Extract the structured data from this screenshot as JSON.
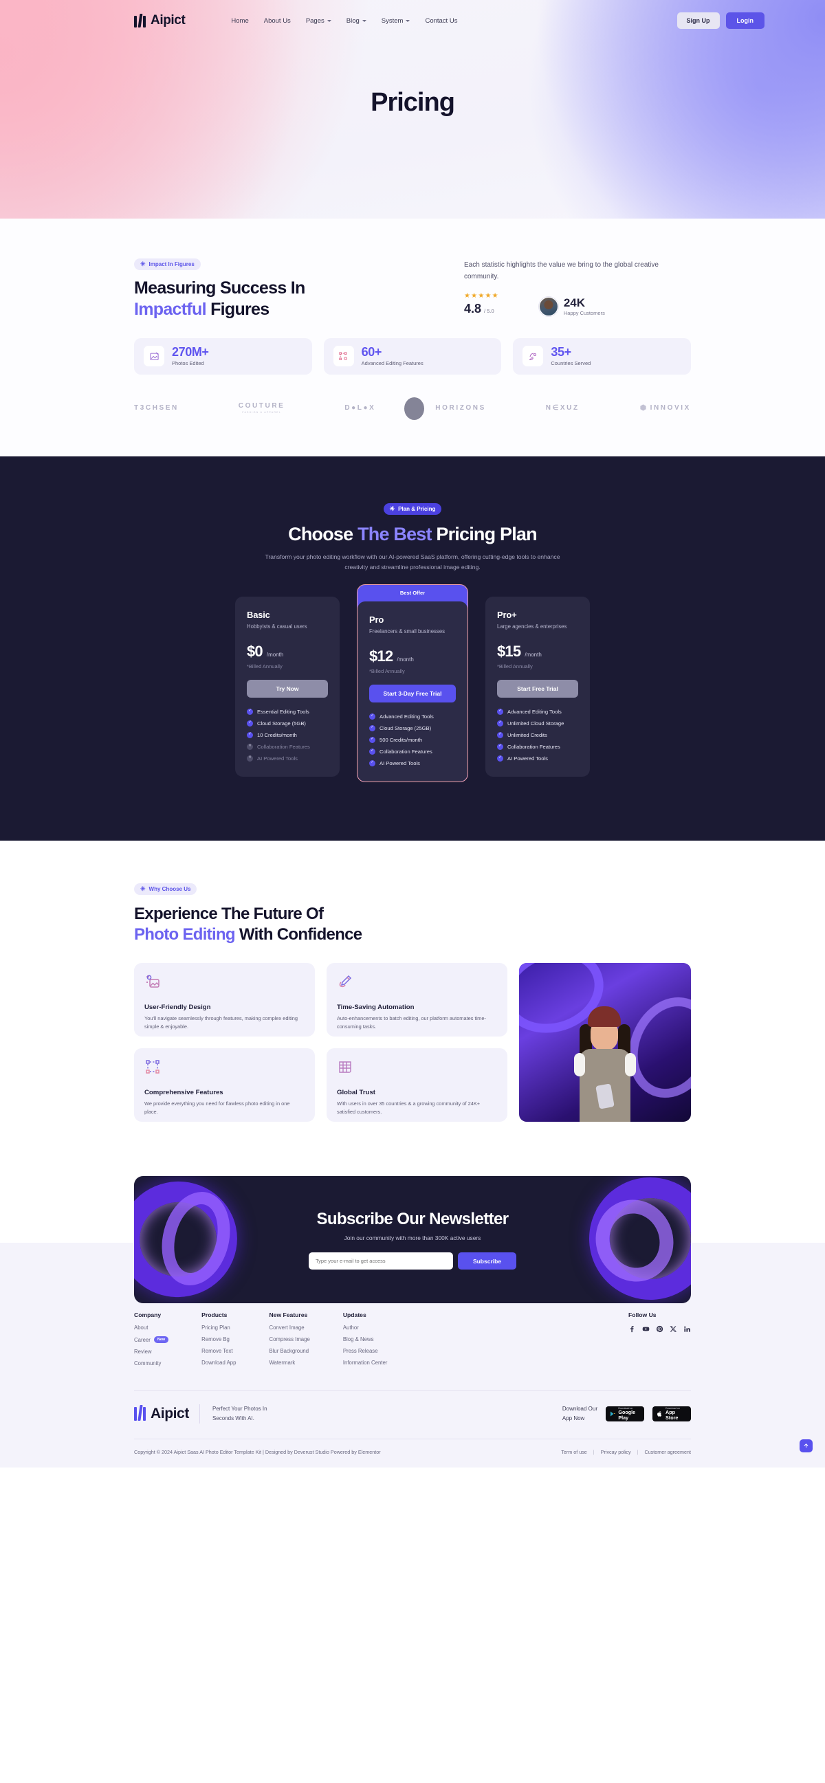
{
  "nav": {
    "brand": "Aipict",
    "links": [
      {
        "label": "Home",
        "caret": false
      },
      {
        "label": "About Us",
        "caret": false
      },
      {
        "label": "Pages",
        "caret": true
      },
      {
        "label": "Blog",
        "caret": true
      },
      {
        "label": "System",
        "caret": true
      },
      {
        "label": "Contact Us",
        "caret": false
      }
    ],
    "signup": "Sign Up",
    "login": "Login"
  },
  "hero": {
    "title": "Pricing"
  },
  "stats": {
    "pill": "Impact In Figures",
    "heading_line1": "Measuring Success In",
    "heading_accent": "Impactful",
    "heading_rest": " Figures",
    "intro": "Each statistic highlights the value we bring to the global creative community.",
    "stars": "★★★★★",
    "rating": "4.8",
    "rating_out_of": "/ 5.0",
    "customers_count": "24K",
    "customers_label": "Happy Customers",
    "cards": [
      {
        "value": "270M+",
        "label": "Photos Edited",
        "icon": "image-edit-icon"
      },
      {
        "value": "60+",
        "label": "Advanced Editing Features",
        "icon": "nodes-settings-icon"
      },
      {
        "value": "35+",
        "label": "Countries Served",
        "icon": "satellite-dish-icon"
      }
    ],
    "logos": [
      {
        "name": "T3CHSEN",
        "sub": ""
      },
      {
        "name": "COUTURE",
        "sub": "FASHION & APPAREL"
      },
      {
        "name": "D●L●X",
        "sub": ""
      },
      {
        "name": "HORIZONS",
        "sub": ""
      },
      {
        "name": "N∈XUZ",
        "sub": ""
      },
      {
        "name": "INNOVIX",
        "sub": ""
      }
    ]
  },
  "pricing": {
    "pill": "Plan & Pricing",
    "heading_pre": "Choose ",
    "heading_accent": "The Best",
    "heading_post": " Pricing Plan",
    "sub": "Transform your photo editing workflow with our AI-powered SaaS platform, offering cutting-edge tools to enhance creativity and streamline professional image editing.",
    "best_offer": "Best Offer",
    "plans": [
      {
        "name": "Basic",
        "desc": "Hobbyists & casual users",
        "price": "$0",
        "period": "/month",
        "billed": "*Billed Annually",
        "cta": "Try Now",
        "features": [
          {
            "label": "Essential Editing Tools",
            "on": true
          },
          {
            "label": "Cloud Storage (5GB)",
            "on": true
          },
          {
            "label": "10 Credits/month",
            "on": true
          },
          {
            "label": "Collaboration Features",
            "on": false
          },
          {
            "label": "AI Powered Tools",
            "on": false
          }
        ]
      },
      {
        "name": "Pro",
        "desc": "Freelancers & small businesses",
        "price": "$12",
        "period": "/month",
        "billed": "*Billed Annually",
        "cta": "Start 3-Day Free Trial",
        "features": [
          {
            "label": "Advanced Editing Tools",
            "on": true
          },
          {
            "label": "Cloud Storage (25GB)",
            "on": true
          },
          {
            "label": "500 Credits/month",
            "on": true
          },
          {
            "label": "Collaboration Features",
            "on": true
          },
          {
            "label": "AI Powered Tools",
            "on": true
          }
        ]
      },
      {
        "name": "Pro+",
        "desc": "Large agencies & enterprises",
        "price": "$15",
        "period": "/month",
        "billed": "*Billed Annually",
        "cta": "Start Free Trial",
        "features": [
          {
            "label": "Advanced Editing Tools",
            "on": true
          },
          {
            "label": "Unlimited Cloud Storage",
            "on": true
          },
          {
            "label": "Unlimited Credits",
            "on": true
          },
          {
            "label": "Collaboration Features",
            "on": true
          },
          {
            "label": "AI Powered Tools",
            "on": true
          }
        ]
      }
    ]
  },
  "why": {
    "pill": "Why Choose Us",
    "heading_line1": "Experience The Future Of",
    "heading_accent": "Photo Editing",
    "heading_rest": " With Confidence",
    "cards": [
      {
        "title": "User-Friendly Design",
        "text": "You'll navigate seamlessly through features, making complex editing simple & enjoyable.",
        "icon": "magic-image-icon"
      },
      {
        "title": "Time-Saving Automation",
        "text": "Auto-enhancements to batch editing, our platform automates time-consuming tasks.",
        "icon": "magic-brush-icon"
      },
      {
        "title": "Comprehensive Features",
        "text": "We provide everything you need for flawless photo editing in one place.",
        "icon": "crop-nodes-icon"
      },
      {
        "title": "Global Trust",
        "text": "With users in over 35 countries & a growing community of 24K+ satisfied customers.",
        "icon": "globe-grid-icon"
      }
    ]
  },
  "newsletter": {
    "title": "Subscribe Our Newsletter",
    "sub": "Join our community with more than 300K active users",
    "placeholder": "Type your e-mail to get access",
    "button": "Subscribe"
  },
  "footer": {
    "columns": [
      {
        "title": "Company",
        "links": [
          {
            "label": "About",
            "badge": ""
          },
          {
            "label": "Career",
            "badge": "New"
          },
          {
            "label": "Review",
            "badge": ""
          },
          {
            "label": "Community",
            "badge": ""
          }
        ]
      },
      {
        "title": "Products",
        "links": [
          {
            "label": "Pricing Plan",
            "badge": ""
          },
          {
            "label": "Remove Bg",
            "badge": ""
          },
          {
            "label": "Remove Text",
            "badge": ""
          },
          {
            "label": "Download App",
            "badge": ""
          }
        ]
      },
      {
        "title": "New Features",
        "links": [
          {
            "label": "Convert Image",
            "badge": ""
          },
          {
            "label": "Compress Image",
            "badge": ""
          },
          {
            "label": "Blur Background",
            "badge": ""
          },
          {
            "label": "Watermark",
            "badge": ""
          }
        ]
      },
      {
        "title": "Updates",
        "links": [
          {
            "label": "Author",
            "badge": ""
          },
          {
            "label": "Blog & News",
            "badge": ""
          },
          {
            "label": "Press Release",
            "badge": ""
          },
          {
            "label": "Information Center",
            "badge": ""
          }
        ]
      }
    ],
    "follow_title": "Follow Us",
    "socials": [
      "facebook-icon",
      "youtube-icon",
      "pinterest-icon",
      "x-twitter-icon",
      "linkedin-icon"
    ],
    "brand": "Aipict",
    "tagline_1": "Perfect Your Photos In",
    "tagline_2": "Seconds With AI.",
    "download_1": "Download Our",
    "download_2": "App Now",
    "stores": [
      {
        "small": "Download on",
        "big": "Google Play",
        "icon": "google-play-icon"
      },
      {
        "small": "Download on",
        "big": "App Store",
        "icon": "apple-icon"
      }
    ],
    "copyright": "Copyright © 2024  Aipict Saas AI Photo Editor Template Kit | Designed by Deverust Studio  Powered by Elementor",
    "legal": [
      "Term of use",
      "Privcay policy",
      "Customer agreement"
    ]
  }
}
